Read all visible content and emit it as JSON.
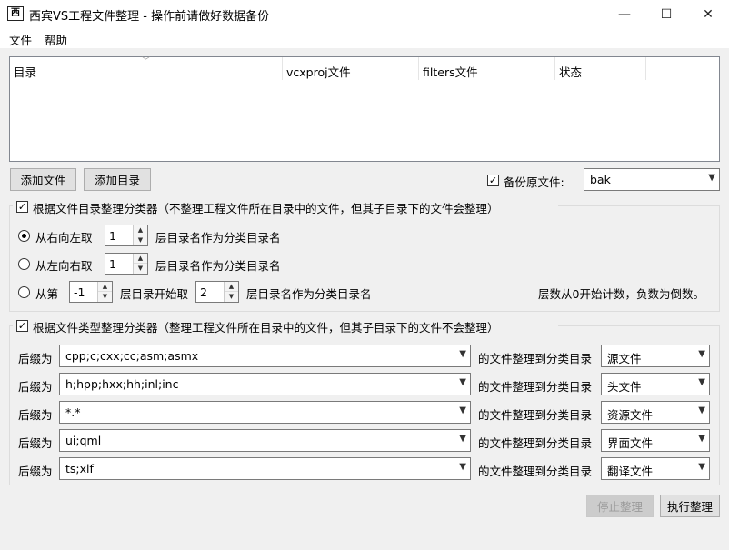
{
  "window": {
    "title": "西宾VS工程文件整理 - 操作前请做好数据备份",
    "icon_text": "西",
    "controls": {
      "minimize": "—",
      "maximize": "☐",
      "close": "✕"
    }
  },
  "menu": {
    "file": "文件",
    "help": "帮助"
  },
  "list": {
    "columns": [
      "目录",
      "vcxproj文件",
      "filters文件",
      "状态"
    ]
  },
  "toolbar": {
    "add_file": "添加文件",
    "add_dir": "添加目录",
    "backup_checked": true,
    "backup_label": "备份原文件:",
    "backup_ext": "bak"
  },
  "dir_group": {
    "checked": true,
    "label": "根据文件目录整理分类器（不整理工程文件所在目录中的文件，但其子目录下的文件会整理）",
    "r1_label": "从右向左取",
    "r1_value": "1",
    "r1_suffix": "层目录名作为分类目录名",
    "r2_label": "从左向右取",
    "r2_value": "1",
    "r2_suffix": "层目录名作为分类目录名",
    "r3_label": "从第",
    "r3_value1": "-1",
    "r3_mid": "层目录开始取",
    "r3_value2": "2",
    "r3_suffix": "层目录名作为分类目录名",
    "note": "层数从0开始计数，负数为倒数。",
    "selected": 1
  },
  "type_group": {
    "checked": true,
    "label": "根据文件类型整理分类器（整理工程文件所在目录中的文件，但其子目录下的文件不会整理）",
    "rows": [
      {
        "prefix": "后缀为",
        "pattern": "cpp;c;cxx;cc;asm;asmx",
        "mid": "的文件整理到分类目录",
        "target": "源文件"
      },
      {
        "prefix": "后缀为",
        "pattern": "h;hpp;hxx;hh;inl;inc",
        "mid": "的文件整理到分类目录",
        "target": "头文件"
      },
      {
        "prefix": "后缀为",
        "pattern": "*.*",
        "mid": "的文件整理到分类目录",
        "target": "资源文件"
      },
      {
        "prefix": "后缀为",
        "pattern": "ui;qml",
        "mid": "的文件整理到分类目录",
        "target": "界面文件"
      },
      {
        "prefix": "后缀为",
        "pattern": "ts;xlf",
        "mid": "的文件整理到分类目录",
        "target": "翻译文件"
      }
    ]
  },
  "actions": {
    "stop": "停止整理",
    "run": "执行整理"
  }
}
